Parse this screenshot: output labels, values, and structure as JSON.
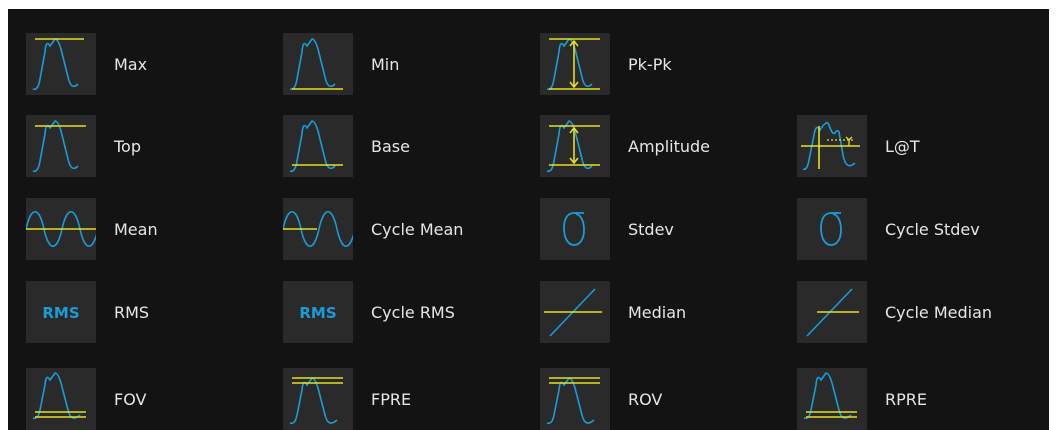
{
  "colors": {
    "background": "#131313",
    "icon_background": "#2a2a2a",
    "waveform": "#1a9cd8",
    "marker": "#e6e020",
    "label_text": "#e6e6e6"
  },
  "measurements": [
    {
      "id": "max",
      "label": "Max",
      "icon": "max-icon"
    },
    {
      "id": "min",
      "label": "Min",
      "icon": "min-icon"
    },
    {
      "id": "pk-pk",
      "label": "Pk-Pk",
      "icon": "pk-pk-icon"
    },
    {
      "id": "top",
      "label": "Top",
      "icon": "top-icon"
    },
    {
      "id": "base",
      "label": "Base",
      "icon": "base-icon"
    },
    {
      "id": "amplitude",
      "label": "Amplitude",
      "icon": "amplitude-icon"
    },
    {
      "id": "l-at-t",
      "label": "L@T",
      "icon": "level-at-time-icon"
    },
    {
      "id": "mean",
      "label": "Mean",
      "icon": "mean-icon"
    },
    {
      "id": "cycle-mean",
      "label": "Cycle Mean",
      "icon": "cycle-mean-icon"
    },
    {
      "id": "stdev",
      "label": "Stdev",
      "icon": "stdev-icon"
    },
    {
      "id": "cycle-stdev",
      "label": "Cycle Stdev",
      "icon": "cycle-stdev-icon"
    },
    {
      "id": "rms",
      "label": "RMS",
      "icon": "rms-icon",
      "icon_text": "RMS"
    },
    {
      "id": "cycle-rms",
      "label": "Cycle RMS",
      "icon": "cycle-rms-icon",
      "icon_text": "RMS"
    },
    {
      "id": "median",
      "label": "Median",
      "icon": "median-icon"
    },
    {
      "id": "cycle-median",
      "label": "Cycle Median",
      "icon": "cycle-median-icon"
    },
    {
      "id": "fov",
      "label": "FOV",
      "icon": "fov-icon"
    },
    {
      "id": "fpre",
      "label": "FPRE",
      "icon": "fpre-icon"
    },
    {
      "id": "rov",
      "label": "ROV",
      "icon": "rov-icon"
    },
    {
      "id": "rpre",
      "label": "RPRE",
      "icon": "rpre-icon"
    }
  ]
}
